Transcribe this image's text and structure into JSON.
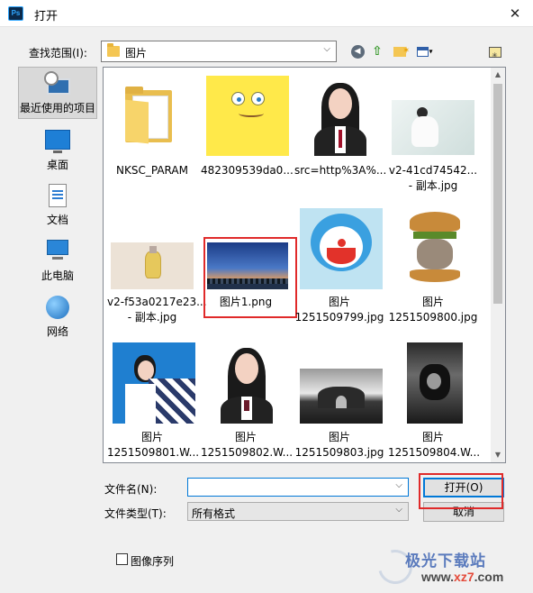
{
  "window": {
    "title": "打开",
    "app_icon": "Ps",
    "close_glyph": "✕"
  },
  "lookin": {
    "label": "查找范围(I):",
    "value": "图片"
  },
  "toolbar": {
    "back_icon": "back-icon",
    "up_icon": "up-folder-icon",
    "new_folder_icon": "new-folder-icon",
    "view_icon": "view-menu-icon"
  },
  "places": [
    {
      "label": "最近使用的项目",
      "icon": "recent-icon",
      "selected": true
    },
    {
      "label": "桌面",
      "icon": "desktop-icon"
    },
    {
      "label": "文档",
      "icon": "documents-icon"
    },
    {
      "label": "此电脑",
      "icon": "this-pc-icon"
    },
    {
      "label": "网络",
      "icon": "network-icon"
    }
  ],
  "files": [
    {
      "line1": "NKSC_PARAM",
      "line2": "",
      "kind": "folder"
    },
    {
      "line1": "482309539da0...",
      "line2": "",
      "kind": "image"
    },
    {
      "line1": "src=http%3A%...",
      "line2": "",
      "kind": "image"
    },
    {
      "line1": "v2-41cd74542...",
      "line2": "- 副本.jpg",
      "kind": "image"
    },
    {
      "line1": "v2-f53a0217e23...",
      "line2": "- 副本.jpg",
      "kind": "image"
    },
    {
      "line1": "图片1.png",
      "line2": "",
      "kind": "image",
      "highlighted": true
    },
    {
      "line1": "图片",
      "line2": "1251509799.jpg",
      "kind": "image"
    },
    {
      "line1": "图片",
      "line2": "1251509800.jpg",
      "kind": "image"
    },
    {
      "line1": "图片",
      "line2": "1251509801.W...",
      "kind": "image"
    },
    {
      "line1": "图片",
      "line2": "1251509802.W...",
      "kind": "image"
    },
    {
      "line1": "图片",
      "line2": "1251509803.jpg",
      "kind": "image"
    },
    {
      "line1": "图片",
      "line2": "1251509804.W...",
      "kind": "image"
    }
  ],
  "form": {
    "filename_label": "文件名(N):",
    "filename_value": "",
    "filetype_label": "文件类型(T):",
    "filetype_value": "所有格式",
    "open_label": "打开(O)",
    "cancel_label": "取消"
  },
  "options": {
    "image_sequence_label": "图像序列",
    "image_sequence_checked": false
  },
  "watermark": {
    "text": "极光下载站",
    "url_prefix": "www.",
    "url_host": "xz7",
    "url_suffix": ".com"
  },
  "colors": {
    "highlight": "#e02a2a",
    "accent": "#0078d7"
  }
}
